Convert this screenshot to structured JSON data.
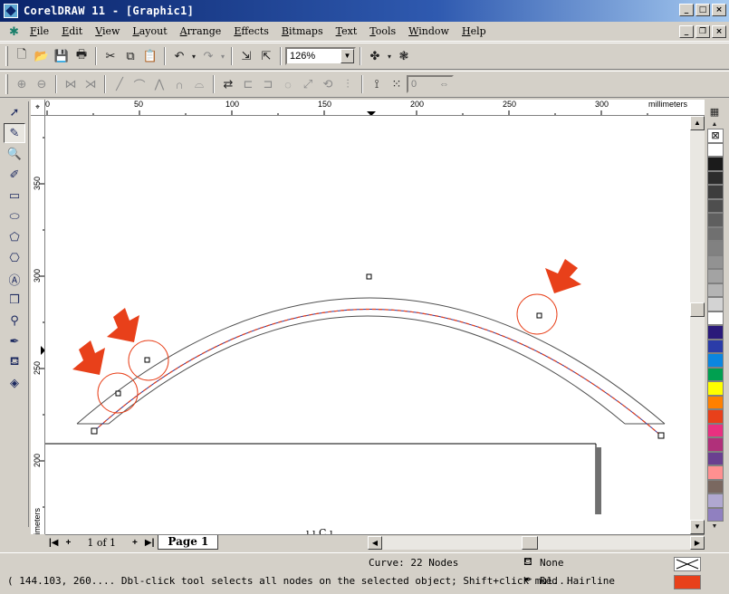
{
  "window": {
    "title": "CorelDRAW 11 - [Graphic1]"
  },
  "menu": [
    "File",
    "Edit",
    "View",
    "Layout",
    "Arrange",
    "Effects",
    "Bitmaps",
    "Text",
    "Tools",
    "Window",
    "Help"
  ],
  "toolbar": {
    "zoom_value": "126%",
    "property_value": "0"
  },
  "rulers": {
    "units": "millimeters",
    "top_labels": [
      "0",
      "50",
      "100",
      "150",
      "200",
      "250",
      "300"
    ],
    "left_labels": [
      "350",
      "300",
      "250",
      "200"
    ]
  },
  "pages": {
    "count_label": "1 of 1",
    "tab_label": "Page 1"
  },
  "status": {
    "curve_info": "Curve: 22 Nodes",
    "coords_hint": "( 144.103, 260.... Dbl-click tool selects all nodes on the selected object; Shift+click mul...",
    "fill_label": "None",
    "outline_color": "Red",
    "outline_width": "Hairline"
  },
  "palette": [
    "#ffffff",
    "#1b1b1b",
    "#2c2c2c",
    "#3d3d3d",
    "#4e4e4e",
    "#5f5f5f",
    "#707070",
    "#818181",
    "#929292",
    "#a3a3a3",
    "#b4b4b4",
    "#d3d3d3",
    "#ffffff",
    "#2a1a7a",
    "#2b3ca8",
    "#0b86e0",
    "#00a050",
    "#ffff00",
    "#ff8000",
    "#e8401a",
    "#e83080",
    "#b0307a",
    "#6a4090",
    "#ff9090",
    "#7a6860",
    "#b0a8d0",
    "#9080c0"
  ],
  "colors": {
    "accent": "#e8401a",
    "title_start": "#0a246a",
    "title_end": "#a6caf0"
  }
}
